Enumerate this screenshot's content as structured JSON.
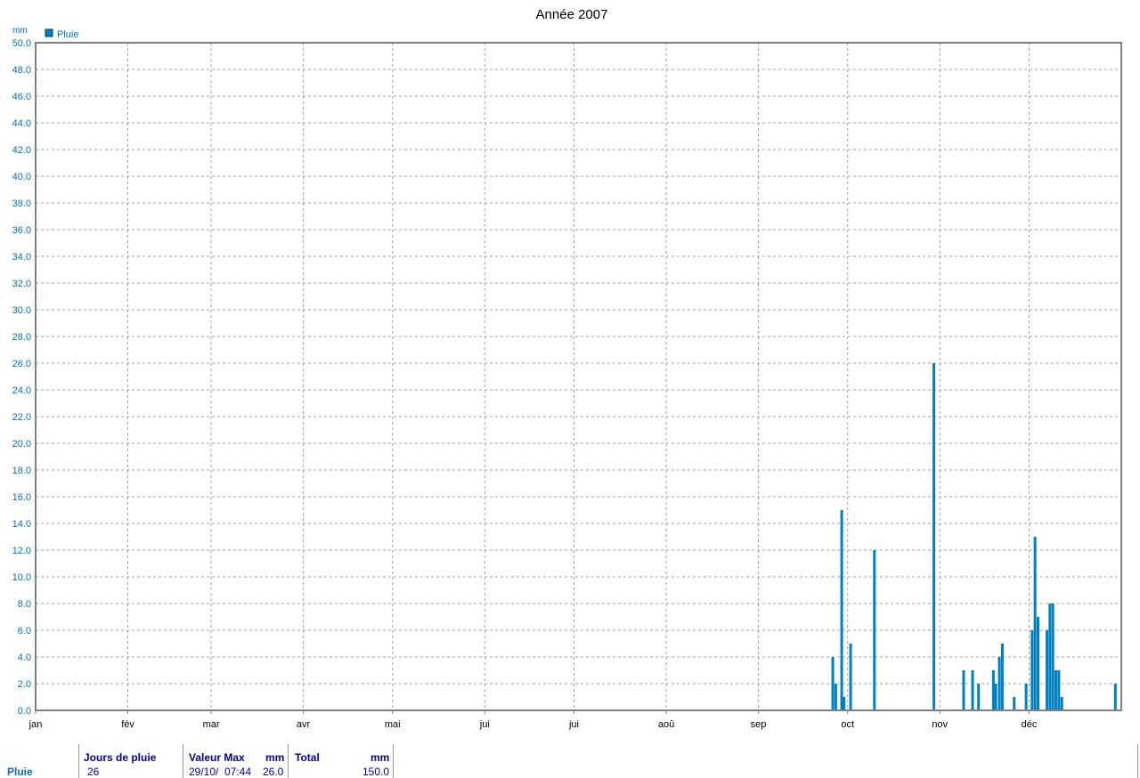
{
  "chart_data": {
    "type": "bar",
    "title": "Année 2007",
    "ylabel": "mm",
    "ylim": [
      0,
      50
    ],
    "yticks": [
      "0.0",
      "2.0",
      "4.0",
      "6.0",
      "8.0",
      "10.0",
      "12.0",
      "14.0",
      "16.0",
      "18.0",
      "20.0",
      "22.0",
      "24.0",
      "26.0",
      "28.0",
      "30.0",
      "32.0",
      "34.0",
      "36.0",
      "38.0",
      "40.0",
      "42.0",
      "44.0",
      "46.0",
      "48.0",
      "50.0"
    ],
    "xlim": [
      0,
      365
    ],
    "xticks": [
      {
        "label": "jan",
        "day": 0
      },
      {
        "label": "fév",
        "day": 31
      },
      {
        "label": "mar",
        "day": 59
      },
      {
        "label": "avr",
        "day": 90
      },
      {
        "label": "mai",
        "day": 120
      },
      {
        "label": "jui",
        "day": 151
      },
      {
        "label": "jui",
        "day": 181
      },
      {
        "label": "aoû",
        "day": 212
      },
      {
        "label": "sep",
        "day": 243
      },
      {
        "label": "oct",
        "day": 273
      },
      {
        "label": "nov",
        "day": 304
      },
      {
        "label": "déc",
        "day": 334
      }
    ],
    "grid": true,
    "legend": "top-left",
    "series": [
      {
        "name": "Pluie",
        "color": "#0080c0",
        "points": [
          {
            "day": 268.0,
            "value": 4
          },
          {
            "day": 269.0,
            "value": 2
          },
          {
            "day": 271.0,
            "value": 15
          },
          {
            "day": 271.8,
            "value": 1
          },
          {
            "day": 274.0,
            "value": 5
          },
          {
            "day": 282.0,
            "value": 12
          },
          {
            "day": 302.0,
            "value": 26
          },
          {
            "day": 312.0,
            "value": 3
          },
          {
            "day": 315.0,
            "value": 3
          },
          {
            "day": 317.0,
            "value": 2
          },
          {
            "day": 322.0,
            "value": 3
          },
          {
            "day": 322.8,
            "value": 2
          },
          {
            "day": 324.0,
            "value": 4
          },
          {
            "day": 325.0,
            "value": 5
          },
          {
            "day": 329.0,
            "value": 1
          },
          {
            "day": 333.0,
            "value": 2
          },
          {
            "day": 335.0,
            "value": 6
          },
          {
            "day": 336.0,
            "value": 13
          },
          {
            "day": 337.0,
            "value": 7
          },
          {
            "day": 340.0,
            "value": 6
          },
          {
            "day": 341.0,
            "value": 8
          },
          {
            "day": 342.0,
            "value": 8
          },
          {
            "day": 343.0,
            "value": 3
          },
          {
            "day": 344.0,
            "value": 3
          },
          {
            "day": 345.0,
            "value": 1
          },
          {
            "day": 363.0,
            "value": 2
          }
        ]
      }
    ]
  },
  "stats": {
    "series_label": "Pluie",
    "jours_header": "Jours de pluie",
    "jours_value": "26",
    "max_header": "Valeur Max",
    "max_unit": "mm",
    "max_date": "29/10/",
    "max_time": "07:44",
    "max_value": "26.0",
    "total_header": "Total",
    "total_unit": "mm",
    "total_value": "150.0"
  }
}
